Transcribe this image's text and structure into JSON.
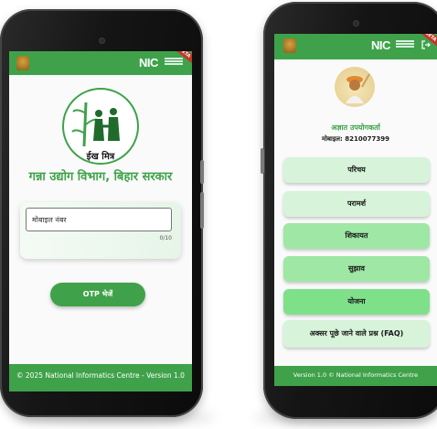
{
  "left_phone": {
    "header": {
      "brand": "NIC"
    },
    "logo_text": "ईख मित्र",
    "department_title": "गन्ना उद्योग विभाग, बिहार सरकार",
    "mobile_input": {
      "placeholder": "मोबाइल नंबर",
      "value": "",
      "counter": "0/10"
    },
    "otp_button": "OTP भेजें",
    "footer": "© 2025 National Informatics Centre - Version 1.0"
  },
  "right_phone": {
    "header": {
      "brand": "NIC"
    },
    "user": {
      "name": "अज्ञात उपयोगकर्ता",
      "mobile": "मोबाइल: 8210077399"
    },
    "menu": [
      {
        "label": "परिचय"
      },
      {
        "label": "परामर्श"
      },
      {
        "label": "शिकायत"
      },
      {
        "label": "सुझाव"
      },
      {
        "label": "योजना"
      },
      {
        "label": "अक्सर पूछे जाने वाले प्रश्न (FAQ)"
      }
    ],
    "footer": "Version 1.0 © National Informatics Centre"
  },
  "colors": {
    "brand_green": "#3fa24a",
    "menu_light": "#d7f3da",
    "menu_mid": "#9ee7a5",
    "menu_dark": "#7fe08a"
  }
}
